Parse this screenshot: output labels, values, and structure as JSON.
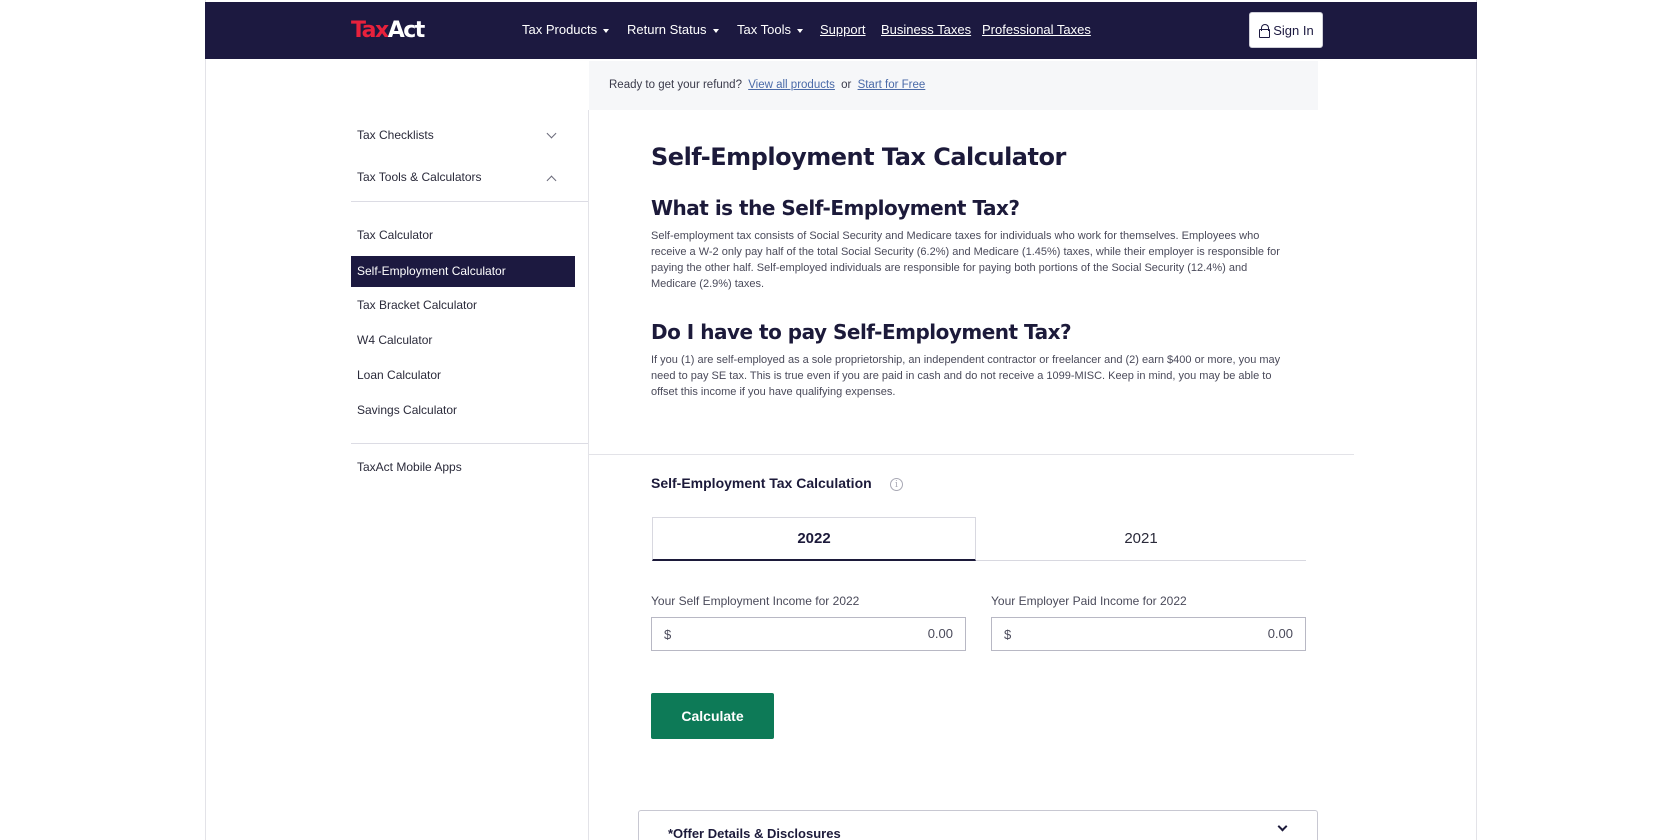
{
  "brand": {
    "logo_part1": "Ta",
    "logo_x": "x",
    "logo_part2": "Act"
  },
  "header": {
    "nav": [
      {
        "label": "Tax Products",
        "dropdown": true
      },
      {
        "label": "Return Status",
        "dropdown": true
      },
      {
        "label": "Tax Tools",
        "dropdown": true
      },
      {
        "label": "Support",
        "dropdown": false
      },
      {
        "label": "Business Taxes",
        "dropdown": false
      },
      {
        "label": "Professional Taxes",
        "dropdown": false
      }
    ],
    "signin_label": "Sign In"
  },
  "promo": {
    "text": "Ready to get your refund?",
    "link1": "View all products",
    "or": "or",
    "link2": "Start for Free"
  },
  "sidebar": {
    "groups": [
      {
        "label": "Tax Checklists",
        "expanded": false
      },
      {
        "label": "Tax Tools & Calculators",
        "expanded": true
      }
    ],
    "items": [
      {
        "label": "Tax Calculator"
      },
      {
        "label": "Self-Employment Calculator",
        "active": true
      },
      {
        "label": "Tax Bracket Calculator"
      },
      {
        "label": "W4 Calculator"
      },
      {
        "label": "Loan Calculator"
      },
      {
        "label": "Savings Calculator"
      }
    ],
    "footer_item": "TaxAct Mobile Apps"
  },
  "main": {
    "title": "Self-Employment Tax Calculator",
    "section1": {
      "heading": "What is the Self-Employment Tax?",
      "body": "Self-employment tax consists of Social Security and Medicare taxes for individuals who work for themselves. Employees who receive a W-2 only pay half of the total Social Security (6.2%) and Medicare (1.45%) taxes, while their employer is responsible for paying the other half. Self-employed individuals are responsible for paying both portions of the Social Security (12.4%) and Medicare (2.9%) taxes."
    },
    "section2": {
      "heading": "Do I have to pay Self-Employment Tax?",
      "body": "If you (1) are self-employed as a sole proprietorship, an independent contractor or freelancer and (2) earn $400 or more, you may need to pay SE tax. This is true even if you are paid in cash and do not receive a 1099-MISC. Keep in mind, you may be able to offset this income if you have qualifying expenses."
    },
    "calculator": {
      "title": "Self-Employment Tax Calculation",
      "info_icon": "i",
      "tabs": [
        {
          "label": "2022",
          "active": true
        },
        {
          "label": "2021",
          "active": false
        }
      ],
      "fields": [
        {
          "label": "Your Self Employment Income for 2022",
          "currency": "$",
          "value": "0.00"
        },
        {
          "label": "Your Employer Paid Income for 2022",
          "currency": "$",
          "value": "0.00"
        }
      ],
      "button_label": "Calculate"
    },
    "offer": {
      "label": "*Offer Details & Disclosures"
    }
  },
  "colors": {
    "header_bg": "#1c1940",
    "brand_red": "#e8213c",
    "button_green": "#0d7a57"
  }
}
